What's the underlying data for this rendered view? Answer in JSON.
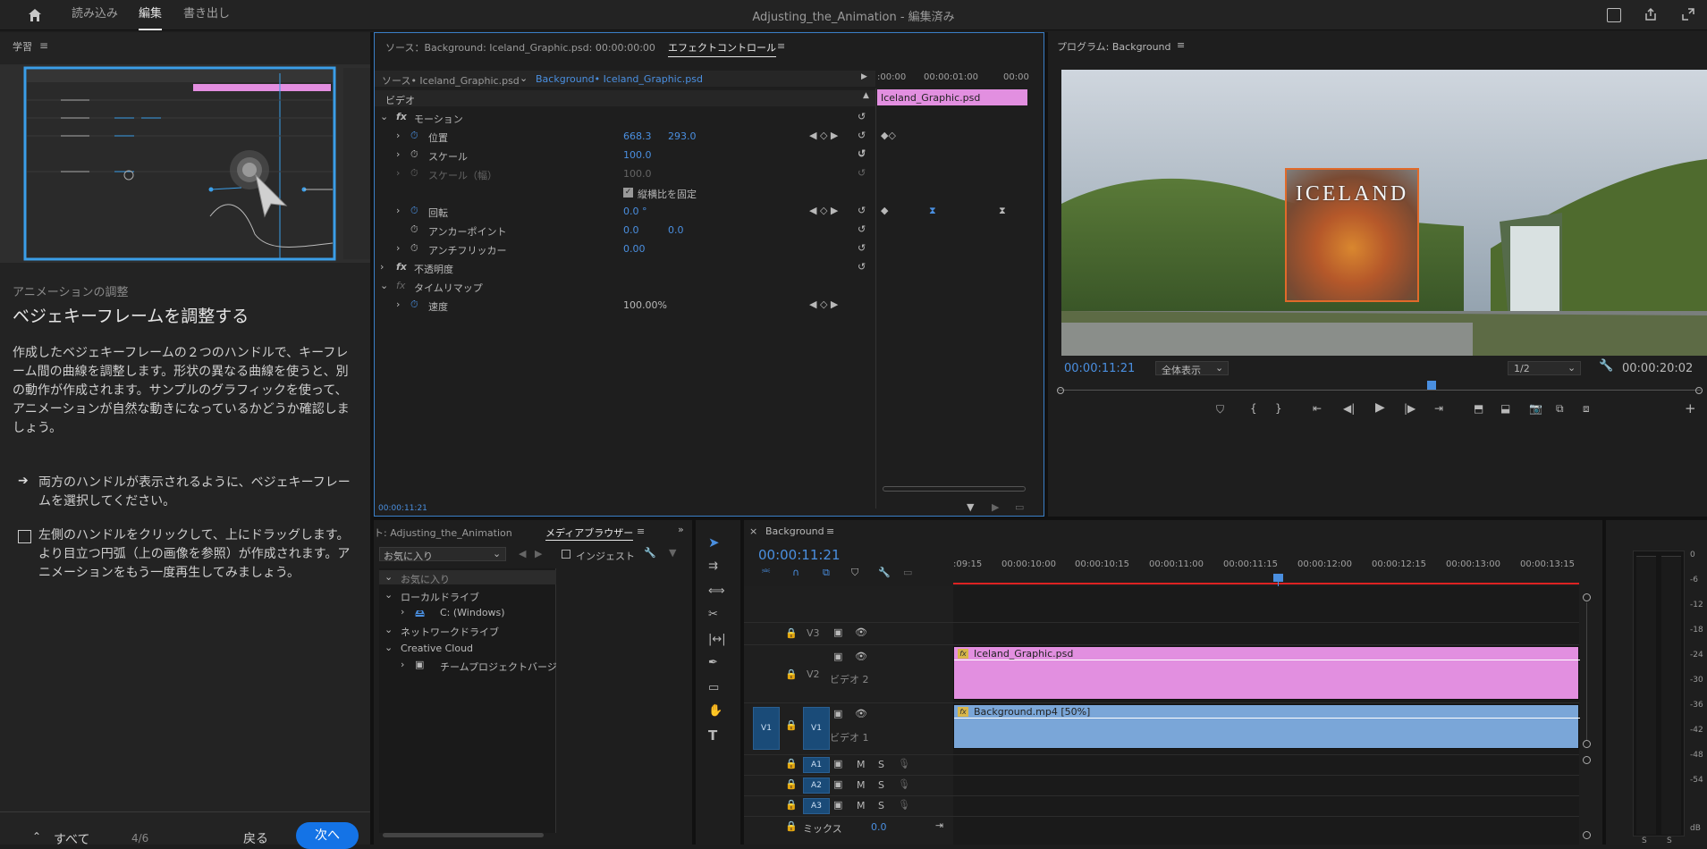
{
  "app": {
    "nav": {
      "import": "読み込み",
      "edit": "編集",
      "export": "書き出し"
    },
    "doc_title": "Adjusting_the_Animation - 編集済み"
  },
  "learn": {
    "panel_title": "学習",
    "section": "アニメーションの調整",
    "heading": "ベジェキーフレームを調整する",
    "body": "作成したベジェキーフレームの２つのハンドルで、キーフレーム間の曲線を調整します。形状の異なる曲線を使うと、別の動作が作成されます。サンプルのグラフィックを使って、アニメーションが自然な動きになっているかどうか確認しましょう。",
    "step1": "両方のハンドルが表示されるように、ベジェキーフレームを選択してください。",
    "step2": "左側のハンドルをクリックして、上にドラッグします。より目立つ円弧（上の画像を参照）が作成されます。アニメーションをもう一度再生してみましょう。",
    "all_label": "すべて",
    "page": "4/6",
    "back": "戻る",
    "next": "次へ"
  },
  "effect_controls": {
    "source_tab": "ソース：Background: Iceland_Graphic.psd: 00:00:00:00",
    "title": "エフェクトコントロール",
    "source_clip": "ソース• Iceland_Graphic.psd",
    "target_clip": "Background• Iceland_Graphic.psd",
    "time_ticks": [
      ":00:00",
      "00:00:01:00",
      "00:00"
    ],
    "clip_label": "Iceland_Graphic.psd",
    "video_label": "ビデオ",
    "motion": "モーション",
    "position": "位置",
    "pos_x": "668.3",
    "pos_y": "293.0",
    "scale": "スケール",
    "scale_val": "100.0",
    "scale_w": "スケール（幅）",
    "scale_w_val": "100.0",
    "uniform": "縦横比を固定",
    "rotation": "回転",
    "rotation_val": "0.0 °",
    "anchor": "アンカーポイント",
    "anchor_x": "0.0",
    "anchor_y": "0.0",
    "flicker": "アンチフリッカー",
    "flicker_val": "0.00",
    "opacity": "不透明度",
    "time_remap": "タイムリマップ",
    "speed": "速度",
    "speed_val": "100.00%",
    "timecode": "00:00:11:21"
  },
  "program": {
    "title": "プログラム: Background",
    "graphic_text": "ICELAND",
    "timecode": "00:00:11:21",
    "fit": "全体表示",
    "resolution": "1/2",
    "duration": "00:00:20:02"
  },
  "project": {
    "title": "ト: Adjusting_the_Animation",
    "media_browser": "メディアブラウザー",
    "favorites_select": "お気に入り",
    "ingest": "インジェスト",
    "tree": {
      "favorites": "お気に入り",
      "local": "ローカルドライブ",
      "c_drive": "C: (Windows)",
      "network": "ネットワークドライブ",
      "cc": "Creative Cloud",
      "team": "チームプロジェクトバージョ"
    }
  },
  "timeline": {
    "title": "Background",
    "timecode": "00:00:11:21",
    "ruler": [
      ":09:15",
      "00:00:10:00",
      "00:00:10:15",
      "00:00:11:00",
      "00:00:11:15",
      "00:00:12:00",
      "00:00:12:15",
      "00:00:13:00",
      "00:00:13:15"
    ],
    "tracks": {
      "v3": "V3",
      "v2": "V2",
      "v2_name": "ビデオ 2",
      "v1": "V1",
      "v1_name": "ビデオ 1",
      "v1_src": "V1",
      "a1": "A1",
      "a2": "A2",
      "a3": "A3",
      "mix": "ミックス",
      "mix_val": "0.0",
      "m": "M",
      "s": "S"
    },
    "clip_v2": "Iceland_Graphic.psd",
    "clip_v1": "Background.mp4 [50%]",
    "fx_badge": "fx"
  },
  "meter": {
    "ticks": [
      "0",
      "-6",
      "-12",
      "-18",
      "-24",
      "-30",
      "-36",
      "-42",
      "-48",
      "-54",
      "dB"
    ],
    "ch": "S"
  },
  "colors": {
    "accent": "#1473e6",
    "timecode": "#4a8fe0",
    "graphic_clip": "#e28fe0",
    "video_clip": "#7aa6d8",
    "playhead": "#4a8fe0"
  }
}
